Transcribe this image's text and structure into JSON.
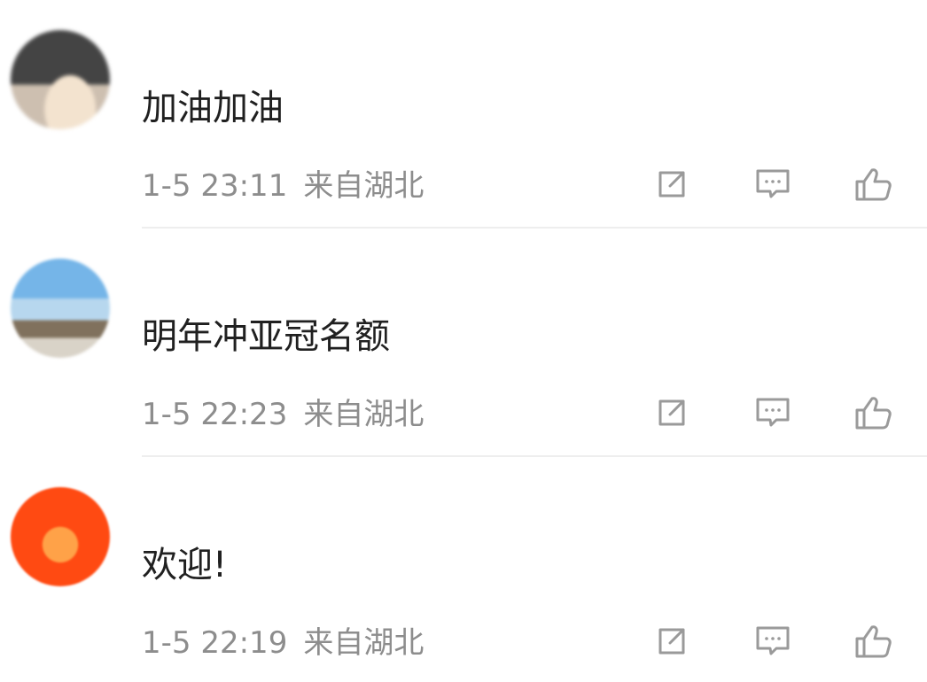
{
  "comments": [
    {
      "content": "加油加油",
      "time": "1-5 23:11",
      "location": "来自湖北",
      "actions": {
        "share_icon": "share-icon",
        "reply_icon": "reply-icon",
        "like_icon": "thumbs-up-icon"
      }
    },
    {
      "content": "明年冲亚冠名额",
      "time": "1-5 22:23",
      "location": "来自湖北",
      "actions": {
        "share_icon": "share-icon",
        "reply_icon": "reply-icon",
        "like_icon": "thumbs-up-icon"
      }
    },
    {
      "content": "欢迎!",
      "time": "1-5 22:19",
      "location": "来自湖北",
      "actions": {
        "share_icon": "share-icon",
        "reply_icon": "reply-icon",
        "like_icon": "thumbs-up-icon"
      }
    }
  ],
  "colors": {
    "background": "#ffffff",
    "content_text": "#202020",
    "meta_text": "#8d8d8d",
    "icon_gray": "#9a9a9a",
    "divider": "#eeeeee"
  }
}
